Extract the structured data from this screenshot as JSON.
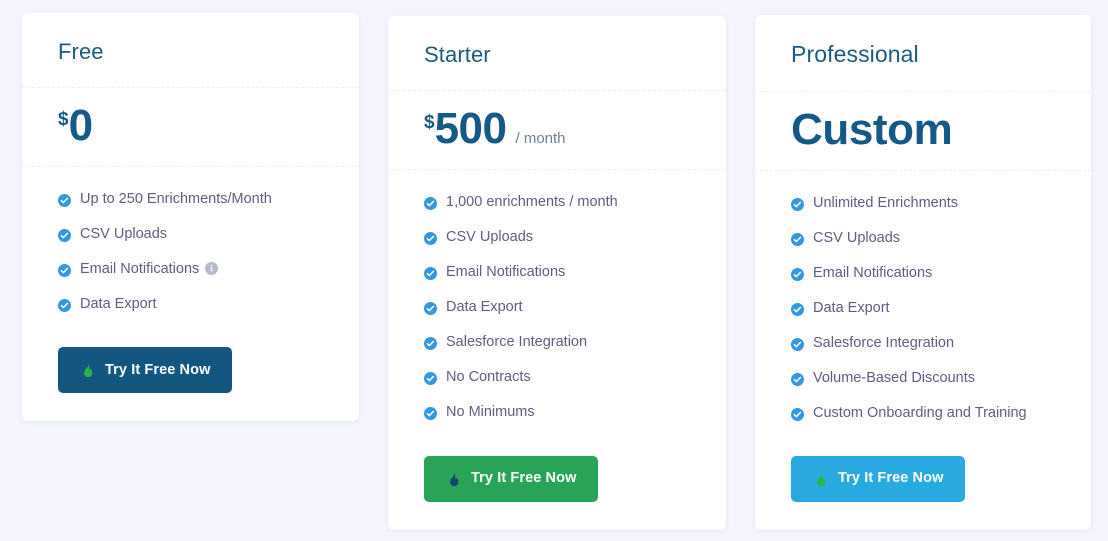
{
  "theme": {
    "page_background": "#f4f5fc",
    "card_background": "#ffffff",
    "heading_color": "#1c5a85",
    "price_color": "#135a86",
    "feature_text_color": "#5c5f80",
    "check_icon_color": "#3398dd",
    "info_icon_color": "#b6bcd0",
    "divider_color": "#eceef6"
  },
  "plans": [
    {
      "id": "free",
      "name": "Free",
      "currency": "$",
      "amount": "0",
      "period": "",
      "features": [
        {
          "label": "Up to 250 Enrichments/Month",
          "info": false
        },
        {
          "label": "CSV Uploads",
          "info": false
        },
        {
          "label": "Email Notifications",
          "info": true
        },
        {
          "label": "Data Export",
          "info": false
        }
      ],
      "cta": {
        "label": "Try It Free Now",
        "background": "#13567f",
        "icon": "flame-icon",
        "icon_color": "#2db24a"
      }
    },
    {
      "id": "starter",
      "name": "Starter",
      "currency": "$",
      "amount": "500",
      "period": "/ month",
      "features": [
        {
          "label": "1,000 enrichments / month",
          "info": false
        },
        {
          "label": "CSV Uploads",
          "info": false
        },
        {
          "label": "Email Notifications",
          "info": false
        },
        {
          "label": "Data Export",
          "info": false
        },
        {
          "label": "Salesforce Integration",
          "info": false
        },
        {
          "label": "No Contracts",
          "info": false
        },
        {
          "label": "No Minimums",
          "info": false
        }
      ],
      "cta": {
        "label": "Try It Free Now",
        "background": "#28a457",
        "icon": "flame-icon",
        "icon_color": "#11456d"
      }
    },
    {
      "id": "professional",
      "name": "Professional",
      "currency": "",
      "amount": "Custom",
      "period": "",
      "features": [
        {
          "label": "Unlimited Enrichments",
          "info": false
        },
        {
          "label": "CSV Uploads",
          "info": false
        },
        {
          "label": "Email Notifications",
          "info": false
        },
        {
          "label": "Data Export",
          "info": false
        },
        {
          "label": "Salesforce Integration",
          "info": false
        },
        {
          "label": "Volume-Based Discounts",
          "info": false
        },
        {
          "label": "Custom Onboarding and Training",
          "info": false
        }
      ],
      "cta": {
        "label": "Try It Free Now",
        "background": "#29abe2",
        "icon": "flame-icon",
        "icon_color": "#2db24a"
      }
    }
  ]
}
